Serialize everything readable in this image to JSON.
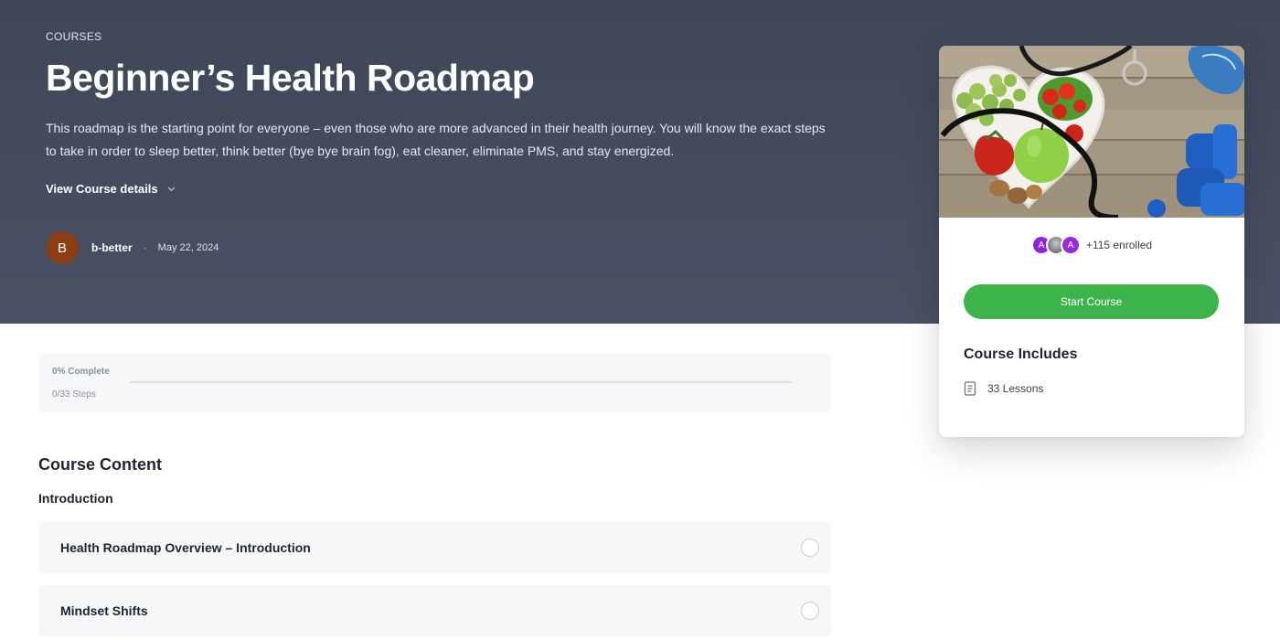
{
  "hero": {
    "eyebrow": "COURSES",
    "title": "Beginner’s Health Roadmap",
    "description": "This roadmap is the starting point for everyone – even those who are more advanced in their health journey. You will know the exact steps to take in order to sleep better, think better (bye bye brain fog), eat cleaner, eliminate PMS, and stay energized.",
    "details_toggle": "View Course details",
    "details_icon": "chevron-down-icon",
    "author": {
      "avatar_letter": "B",
      "avatar_color": "#8b3d13",
      "name": "b-better",
      "separator": "·",
      "date": "May 22, 2024"
    }
  },
  "progress": {
    "percent_label": "0% Complete",
    "steps_label": "0/33 Steps",
    "fraction": 0
  },
  "content": {
    "title": "Course Content",
    "group": "Introduction",
    "lessons": [
      {
        "title": "Health Roadmap Overview – Introduction",
        "status_icon": "incomplete-circle-icon"
      },
      {
        "title": "Mindset Shifts",
        "status_icon": "incomplete-circle-icon"
      }
    ]
  },
  "sidebar": {
    "image_icon": "healthy-food-dumbbells-image",
    "avatars": [
      {
        "letter": "A",
        "color": "#8e24d8"
      },
      {
        "letter": "",
        "color": "#8c8c8c"
      },
      {
        "letter": "A",
        "color": "#9b2ad9"
      }
    ],
    "enrolled_text": "+115 enrolled",
    "start_button": "Start Course",
    "start_button_color": "#3cb44a",
    "includes_title": "Course Includes",
    "includes_items": [
      {
        "icon": "lesson-book-icon",
        "label": "33 Lessons"
      }
    ]
  }
}
